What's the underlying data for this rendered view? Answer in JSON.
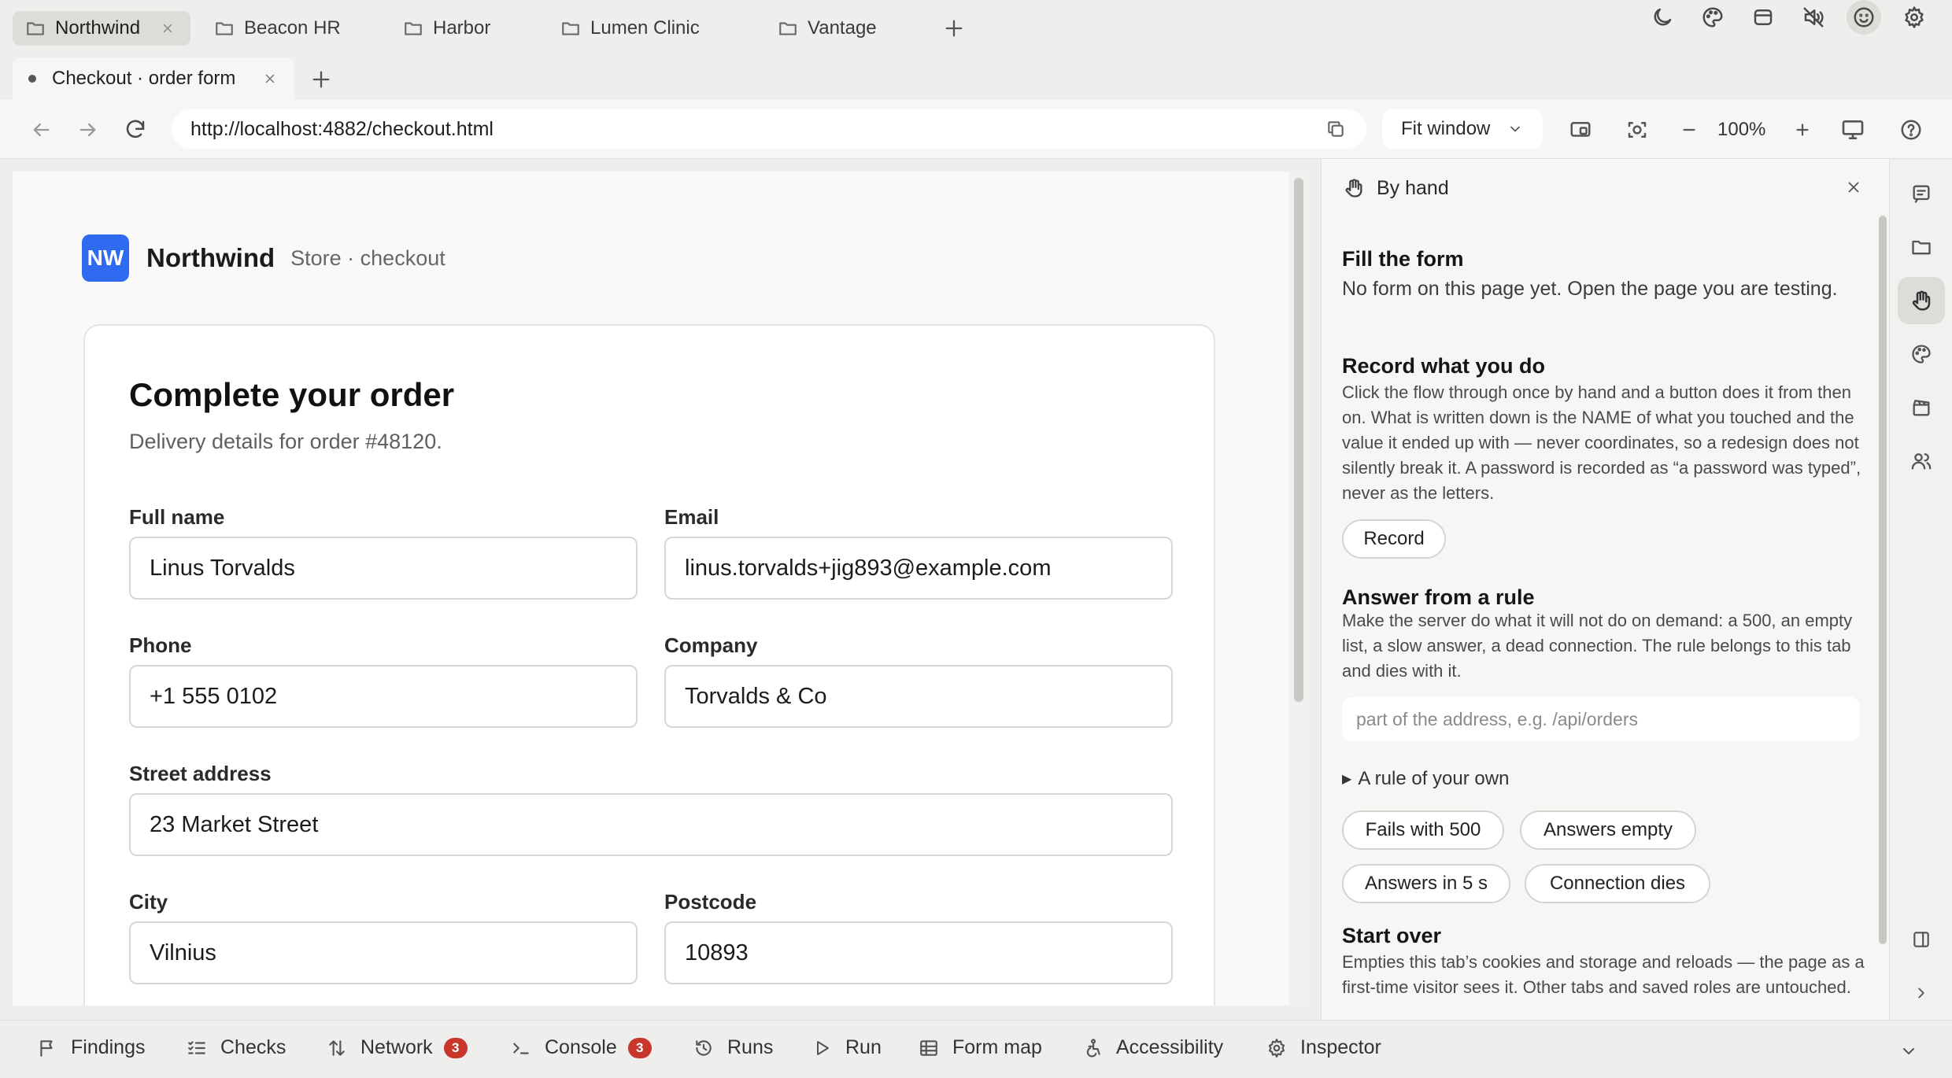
{
  "workspace_tabs": [
    {
      "label": "Northwind",
      "active": true
    },
    {
      "label": "Beacon HR"
    },
    {
      "label": "Harbor"
    },
    {
      "label": "Lumen Clinic"
    },
    {
      "label": "Vantage"
    }
  ],
  "page_tab": {
    "label": "Checkout · order form"
  },
  "nav": {
    "url": "http://localhost:4882/checkout.html",
    "fit_mode": "Fit window",
    "zoom": "100%"
  },
  "page": {
    "brand_logo": "NW",
    "brand_name": "Northwind",
    "brand_sub": "Store · checkout",
    "title": "Complete your order",
    "subtitle": "Delivery details for order #48120.",
    "fields": {
      "full_name": {
        "label": "Full name",
        "value": "Linus Torvalds"
      },
      "email": {
        "label": "Email",
        "value": "linus.torvalds+jig893@example.com"
      },
      "phone": {
        "label": "Phone",
        "value": "+1 555 0102"
      },
      "company": {
        "label": "Company",
        "value": "Torvalds & Co"
      },
      "street": {
        "label": "Street address",
        "value": "23 Market Street"
      },
      "city": {
        "label": "City",
        "value": "Vilnius"
      },
      "postcode": {
        "label": "Postcode",
        "value": "10893"
      }
    }
  },
  "panel": {
    "header": "By hand",
    "fill": {
      "title": "Fill the form",
      "text": "No form on this page yet. Open the page you are testing."
    },
    "record": {
      "title": "Record what you do",
      "text": "Click the flow through once by hand and a button does it from then on. What is written down is the NAME of what you touched and the value it ended up with — never coordinates, so a redesign does not silently break it. A password is recorded as “a password was typed”, never as the letters.",
      "button": "Record"
    },
    "rule": {
      "title": "Answer from a rule",
      "text": "Make the server do what it will not do on demand: a 500, an empty list, a slow answer, a dead connection. The rule belongs to this tab and dies with it.",
      "placeholder": "part of the address, e.g. /api/orders",
      "disclosure": "A rule of your own",
      "presets": [
        "Fails with 500",
        "Answers empty",
        "Answers in 5 s",
        "Connection dies"
      ]
    },
    "start_over": {
      "title": "Start over",
      "text": "Empties this tab’s cookies and storage and reloads — the page as a first-time visitor sees it. Other tabs and saved roles are untouched."
    }
  },
  "bottom_tabs": [
    {
      "label": "Findings",
      "icon": "flag-icon"
    },
    {
      "label": "Checks",
      "icon": "checklist-icon"
    },
    {
      "label": "Network",
      "icon": "arrows-updown-icon",
      "badge": "3"
    },
    {
      "label": "Console",
      "icon": "terminal-icon",
      "badge": "3"
    },
    {
      "label": "Runs",
      "icon": "history-icon"
    },
    {
      "label": "Run",
      "icon": "play-icon"
    },
    {
      "label": "Form map",
      "icon": "table-icon"
    },
    {
      "label": "Accessibility",
      "icon": "accessibility-icon"
    },
    {
      "label": "Inspector",
      "icon": "inspector-icon"
    }
  ],
  "colors": {
    "brand": "#2f6bf1",
    "badge": "#c9362b",
    "chrome_bg": "#efeeec"
  }
}
